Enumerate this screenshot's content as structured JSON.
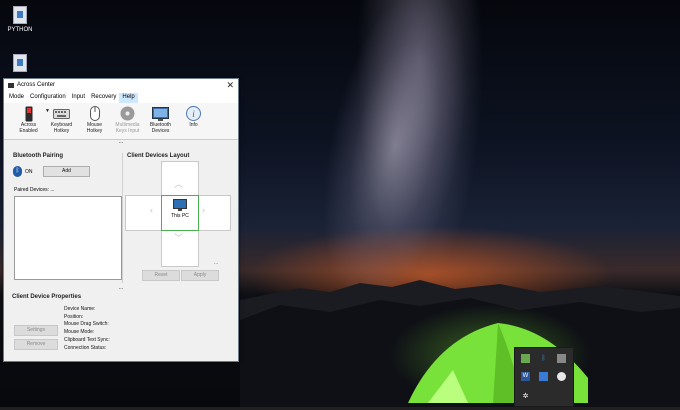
{
  "desktop": {
    "icons": [
      {
        "label": "PYTHON"
      },
      {
        "label": ""
      }
    ]
  },
  "window": {
    "title": "Across Center",
    "close_glyph": "✕",
    "menu": [
      "Mode",
      "Configuration",
      "Input",
      "Recovery",
      "Help"
    ],
    "active_menu": "Help",
    "toolbar": [
      {
        "label": "Across\nEnabled",
        "icon": "toggle-switch-icon",
        "enabled": true
      },
      {
        "label": "Keyboard\nHotkey",
        "icon": "keyboard-icon",
        "enabled": true
      },
      {
        "label": "Mouse\nHotkey",
        "icon": "mouse-icon",
        "enabled": true
      },
      {
        "label": "Multimedia\nKeys Input",
        "icon": "media-disc-icon",
        "enabled": false
      },
      {
        "label": "Bluetooth\nDevices",
        "icon": "bluetooth-devices-icon",
        "enabled": true
      },
      {
        "label": "Info",
        "icon": "info-icon",
        "enabled": true
      }
    ],
    "toolbar_dots": "...",
    "bluetooth_pairing": {
      "title": "Bluetooth Pairing",
      "state": "ON",
      "add_label": "Add",
      "paired_label": "Paired Devices: ..."
    },
    "client_layout": {
      "title": "Client Devices Layout",
      "center_label": "This PC",
      "more": "...",
      "reset_label": "Reset",
      "apply_label": "Apply"
    },
    "section_dots": "...",
    "properties": {
      "title": "Client Device Properties",
      "settings_label": "Settings",
      "remove_label": "Remove",
      "fields": [
        "Device Name:",
        "Position:",
        "Mouse Drag Switch:",
        "Mouse Mode:",
        "Clipboard Text Sync:",
        "Connection Status:"
      ]
    }
  },
  "tray": {
    "icons": [
      "chat-icon",
      "bluetooth-icon",
      "device-icon",
      "word-icon",
      "mail-icon",
      "chrome-icon",
      "settings-icon"
    ]
  },
  "colors": {
    "accent_blue": "#1e5ba8",
    "layout_selected": "#4caf50",
    "menu_highlight": "#cde8ff"
  }
}
